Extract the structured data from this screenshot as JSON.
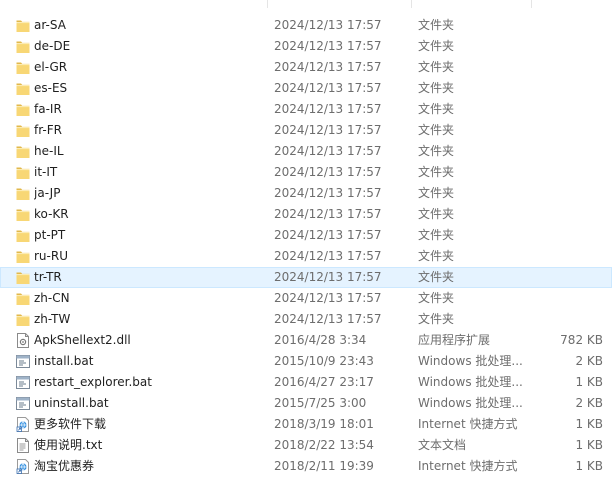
{
  "colors": {
    "folder": "#f8d775",
    "folder_dark": "#e2b84b",
    "hover_row": "#e5f3ff",
    "hover_border": "#cce8ff",
    "meta_text": "#6d6d6d"
  },
  "files": [
    {
      "name": "ar-SA",
      "date": "2024/12/13 17:57",
      "type": "文件夹",
      "size": "",
      "icon": "folder-icon",
      "hover": false
    },
    {
      "name": "de-DE",
      "date": "2024/12/13 17:57",
      "type": "文件夹",
      "size": "",
      "icon": "folder-icon",
      "hover": false
    },
    {
      "name": "el-GR",
      "date": "2024/12/13 17:57",
      "type": "文件夹",
      "size": "",
      "icon": "folder-icon",
      "hover": false
    },
    {
      "name": "es-ES",
      "date": "2024/12/13 17:57",
      "type": "文件夹",
      "size": "",
      "icon": "folder-icon",
      "hover": false
    },
    {
      "name": "fa-IR",
      "date": "2024/12/13 17:57",
      "type": "文件夹",
      "size": "",
      "icon": "folder-icon",
      "hover": false
    },
    {
      "name": "fr-FR",
      "date": "2024/12/13 17:57",
      "type": "文件夹",
      "size": "",
      "icon": "folder-icon",
      "hover": false
    },
    {
      "name": "he-IL",
      "date": "2024/12/13 17:57",
      "type": "文件夹",
      "size": "",
      "icon": "folder-icon",
      "hover": false
    },
    {
      "name": "it-IT",
      "date": "2024/12/13 17:57",
      "type": "文件夹",
      "size": "",
      "icon": "folder-icon",
      "hover": false
    },
    {
      "name": "ja-JP",
      "date": "2024/12/13 17:57",
      "type": "文件夹",
      "size": "",
      "icon": "folder-icon",
      "hover": false
    },
    {
      "name": "ko-KR",
      "date": "2024/12/13 17:57",
      "type": "文件夹",
      "size": "",
      "icon": "folder-icon",
      "hover": false
    },
    {
      "name": "pt-PT",
      "date": "2024/12/13 17:57",
      "type": "文件夹",
      "size": "",
      "icon": "folder-icon",
      "hover": false
    },
    {
      "name": "ru-RU",
      "date": "2024/12/13 17:57",
      "type": "文件夹",
      "size": "",
      "icon": "folder-icon",
      "hover": false
    },
    {
      "name": "tr-TR",
      "date": "2024/12/13 17:57",
      "type": "文件夹",
      "size": "",
      "icon": "folder-icon",
      "hover": true
    },
    {
      "name": "zh-CN",
      "date": "2024/12/13 17:57",
      "type": "文件夹",
      "size": "",
      "icon": "folder-icon",
      "hover": false
    },
    {
      "name": "zh-TW",
      "date": "2024/12/13 17:57",
      "type": "文件夹",
      "size": "",
      "icon": "folder-icon",
      "hover": false
    },
    {
      "name": "ApkShellext2.dll",
      "date": "2016/4/28 3:34",
      "type": "应用程序扩展",
      "size": "782 KB",
      "icon": "dll-file-icon",
      "hover": false
    },
    {
      "name": "install.bat",
      "date": "2015/10/9 23:43",
      "type": "Windows 批处理...",
      "size": "2 KB",
      "icon": "batch-file-icon",
      "hover": false
    },
    {
      "name": "restart_explorer.bat",
      "date": "2016/4/27 23:17",
      "type": "Windows 批处理...",
      "size": "1 KB",
      "icon": "batch-file-icon",
      "hover": false
    },
    {
      "name": "uninstall.bat",
      "date": "2015/7/25 3:00",
      "type": "Windows 批处理...",
      "size": "2 KB",
      "icon": "batch-file-icon",
      "hover": false
    },
    {
      "name": "更多软件下载",
      "date": "2018/3/19 18:01",
      "type": "Internet 快捷方式",
      "size": "1 KB",
      "icon": "internet-shortcut-icon",
      "hover": false
    },
    {
      "name": "使用说明.txt",
      "date": "2018/2/22 13:54",
      "type": "文本文档",
      "size": "1 KB",
      "icon": "text-file-icon",
      "hover": false
    },
    {
      "name": "淘宝优惠券",
      "date": "2018/2/11 19:39",
      "type": "Internet 快捷方式",
      "size": "1 KB",
      "icon": "internet-shortcut-icon",
      "hover": false
    }
  ]
}
